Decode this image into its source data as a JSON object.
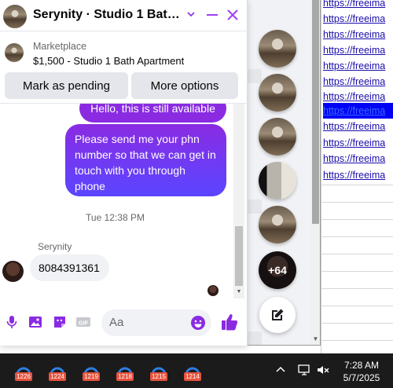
{
  "chat": {
    "title": "Serynity · Studio 1 Bath Ap...",
    "listing_category": "Marketplace",
    "listing_title": "$1,500 - Studio 1 Bath Apartment",
    "mark_pending_label": "Mark as pending",
    "more_options_label": "More options",
    "messages": {
      "out_1": "Hello, this is still available",
      "out_2": "Please send me your phn number so that we can get in touch with you through phone",
      "timestamp": "Tue 12:38 PM",
      "sender_name": "Serynity",
      "in_1": "8084391361"
    },
    "composer_placeholder": "Aa",
    "accent_color": "#8a2be2"
  },
  "chat_heads": {
    "more_count": "+64"
  },
  "sheet": {
    "links": [
      "https://freeima",
      "https://freeima",
      "https://freeima",
      "https://freeima",
      "https://freeima",
      "https://freeima",
      "https://freeima",
      "https://freeima",
      "https://freeima",
      "https://freeima",
      "https://freeima"
    ]
  },
  "taskbar": {
    "apps": [
      {
        "badge": "1226"
      },
      {
        "badge": "1224"
      },
      {
        "badge": "1219"
      },
      {
        "badge": "1218"
      },
      {
        "badge": "1215"
      },
      {
        "badge": "1214"
      }
    ],
    "time": "7:28 AM",
    "date": "5/7/2025"
  },
  "icons": [
    "chevron-down-icon",
    "minimize-icon",
    "close-icon",
    "microphone-icon",
    "image-icon",
    "sticker-icon",
    "gif-icon",
    "emoji-icon",
    "thumbs-up-icon",
    "compose-icon",
    "chevron-up-icon",
    "display-icon",
    "volume-muted-icon"
  ]
}
